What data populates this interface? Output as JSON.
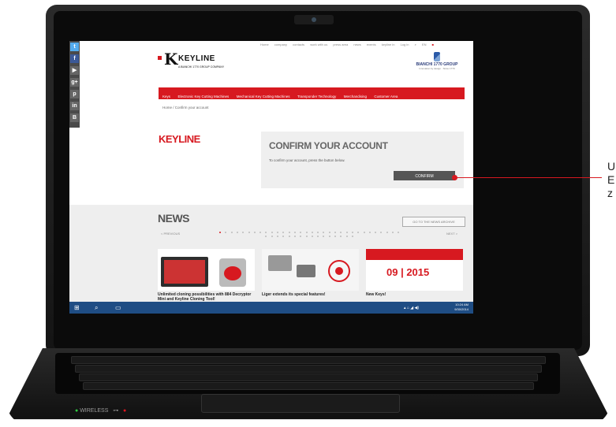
{
  "social": [
    "twitter-icon",
    "facebook-icon",
    "youtube-icon",
    "googleplus-icon",
    "pinterest-icon",
    "linkedin-icon",
    "blogger-icon"
  ],
  "top_nav": [
    "Home",
    "company",
    "contacts",
    "work with us",
    "press area",
    "news",
    "events",
    "keyline in",
    "Log in",
    "EN"
  ],
  "logo": {
    "name": "KEYLINE",
    "subtitle": "A BIANCHI 1770 GROUP COMPANY"
  },
  "bianchi": {
    "name": "BIANCHI 1770 GROUP",
    "tagline": "Innovation by design · Since 1770"
  },
  "main_nav": [
    "Keys",
    "Electronic Key Cutting Machines",
    "Mechanical Key Cutting Machines",
    "Transponder Technology",
    "Merchandising",
    "Customer Area"
  ],
  "breadcrumb": "Home  /  Confirm your account",
  "keyline_title": "KEYLINE",
  "confirm": {
    "title": "CONFIRM YOUR ACCOUNT",
    "text": "To confirm your account, press the button below.",
    "button": "CONFIRM"
  },
  "news": {
    "title": "NEWS",
    "archive": "GO TO THE NEWS ARCHIVE",
    "prev": "< PREVIOUS",
    "next": "NEXT >",
    "cards": [
      {
        "title": "Unlimited cloning possibilities with 884 Decryptor Mini and Keyline Cloning Tool!"
      },
      {
        "title": "Liger extends its special features!"
      },
      {
        "title": "New Keys!",
        "date": "09 | 2015"
      }
    ]
  },
  "taskbar": {
    "time": "10:24 AM",
    "date": "9/30/2014"
  },
  "laptop": {
    "wireless": "WIRELESS"
  },
  "callout": {
    "lines": [
      "U",
      "E",
      "z"
    ]
  },
  "colors": {
    "brand_red": "#d71920",
    "taskbar_blue": "#1f4d84"
  }
}
